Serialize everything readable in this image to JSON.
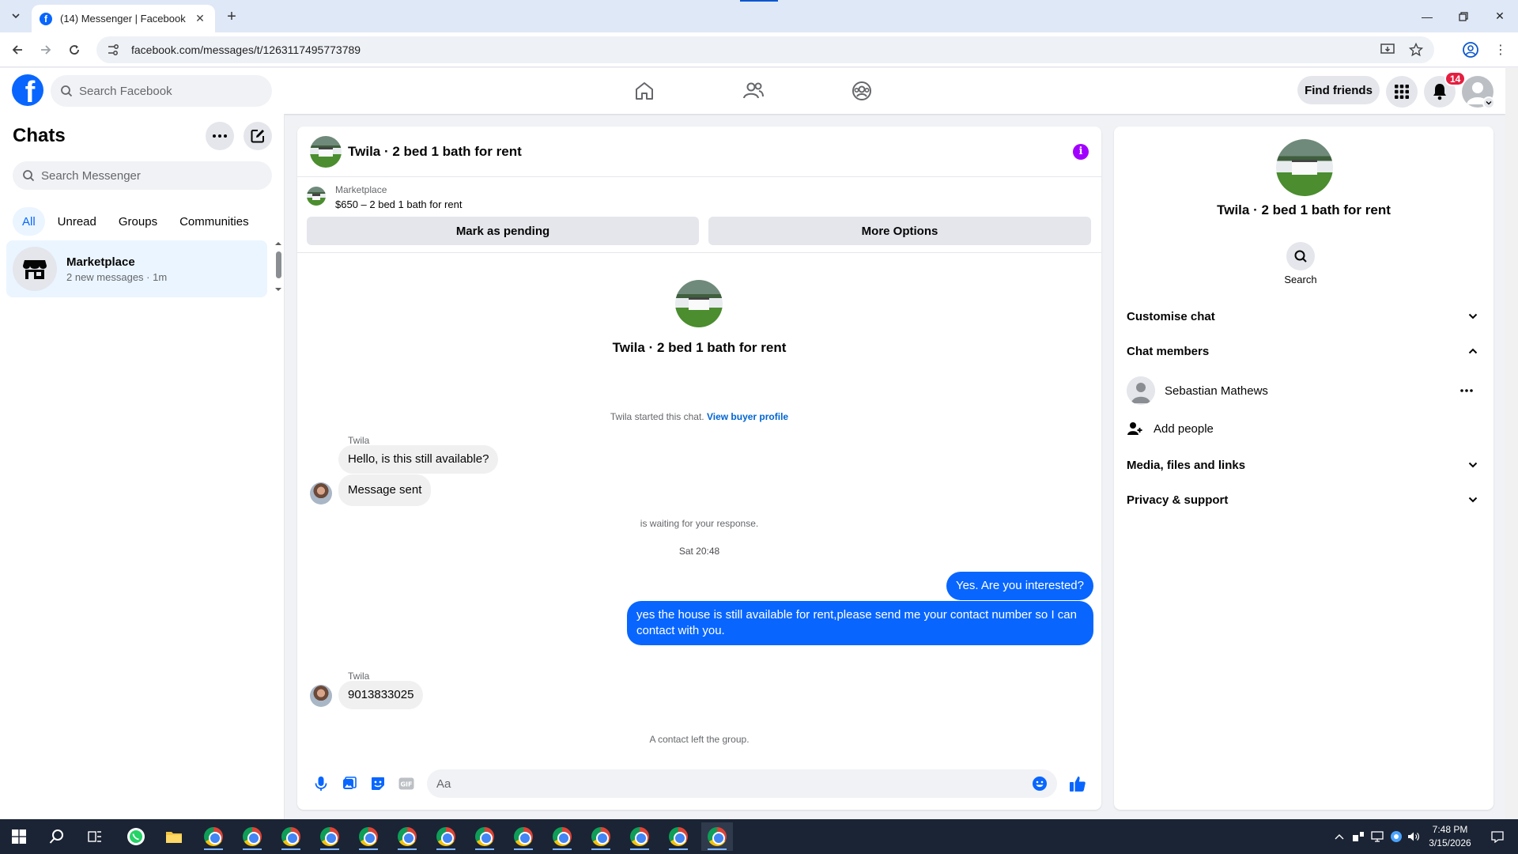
{
  "browser": {
    "tab_title": "(14) Messenger | Facebook",
    "url": "facebook.com/messages/t/1263117495773789"
  },
  "fb_header": {
    "search_placeholder": "Search Facebook",
    "find_friends": "Find friends",
    "notification_count": "14"
  },
  "chats": {
    "title": "Chats",
    "search_placeholder": "Search Messenger",
    "filters": [
      "All",
      "Unread",
      "Groups",
      "Communities"
    ],
    "items": [
      {
        "name": "Marketplace",
        "subtitle": "2 new messages · 1m"
      }
    ]
  },
  "conversation": {
    "title": "Twila · 2 bed 1 bath for rent",
    "marketplace_label": "Marketplace",
    "listing": "$650 – 2 bed 1 bath for rent",
    "mark_pending": "Mark as pending",
    "more_options": "More Options",
    "intro_name": "Twila · 2 bed 1 bath for rent",
    "started_text": "Twila started this chat.",
    "view_profile": "View buyer profile",
    "sender1": "Twila",
    "msg1": "Hello, is this still available?",
    "msg2": "Message sent",
    "waiting": "is waiting for your response.",
    "timestamp": "Sat 20:48",
    "out1": "Yes. Are you interested?",
    "out2": "yes the house is still available for rent,please send me your contact number so I can contact with you.",
    "sender2": "Twila",
    "msg3": "9013833025",
    "left_group": "A contact left the group.",
    "composer_placeholder": "Aa"
  },
  "details": {
    "name": "Twila · 2 bed 1 bath for rent",
    "search_label": "Search",
    "customise": "Customise chat",
    "members_header": "Chat members",
    "member_name": "Sebastian Mathews",
    "add_people": "Add people",
    "media": "Media, files and links",
    "privacy": "Privacy & support"
  },
  "taskbar": {
    "time": "7:48 PM",
    "date": "3/15/2026"
  },
  "colors": {
    "fb_blue": "#0866ff",
    "info_purple": "#a100ff",
    "badge_red": "#e41e3f"
  }
}
